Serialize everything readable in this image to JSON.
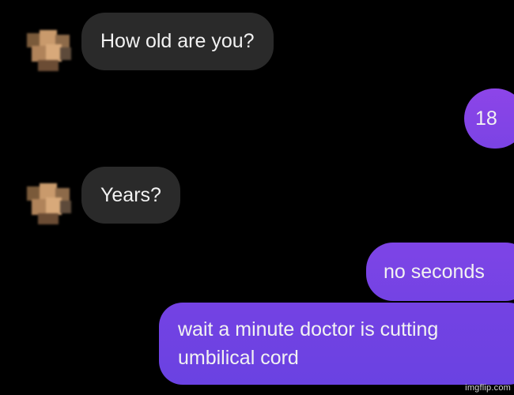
{
  "conversation": {
    "messages": [
      {
        "side": "incoming",
        "text": "How old are you?"
      },
      {
        "side": "outgoing",
        "text": "18"
      },
      {
        "side": "incoming",
        "text": "Years?"
      },
      {
        "side": "outgoing",
        "text": "no seconds"
      },
      {
        "side": "outgoing",
        "lines": [
          "wait a minute doctor is cutting",
          "umbilical cord"
        ]
      }
    ]
  },
  "watermark": "imgflip.com",
  "colors": {
    "background": "#000000",
    "incoming_bubble": "#2a2a2a",
    "outgoing_bubble_top": "#8a45e6",
    "outgoing_bubble_bottom": "#6f42e2",
    "text": "#f2f2f2"
  },
  "icons": {
    "avatar": "blurred-profile-photo-icon"
  }
}
